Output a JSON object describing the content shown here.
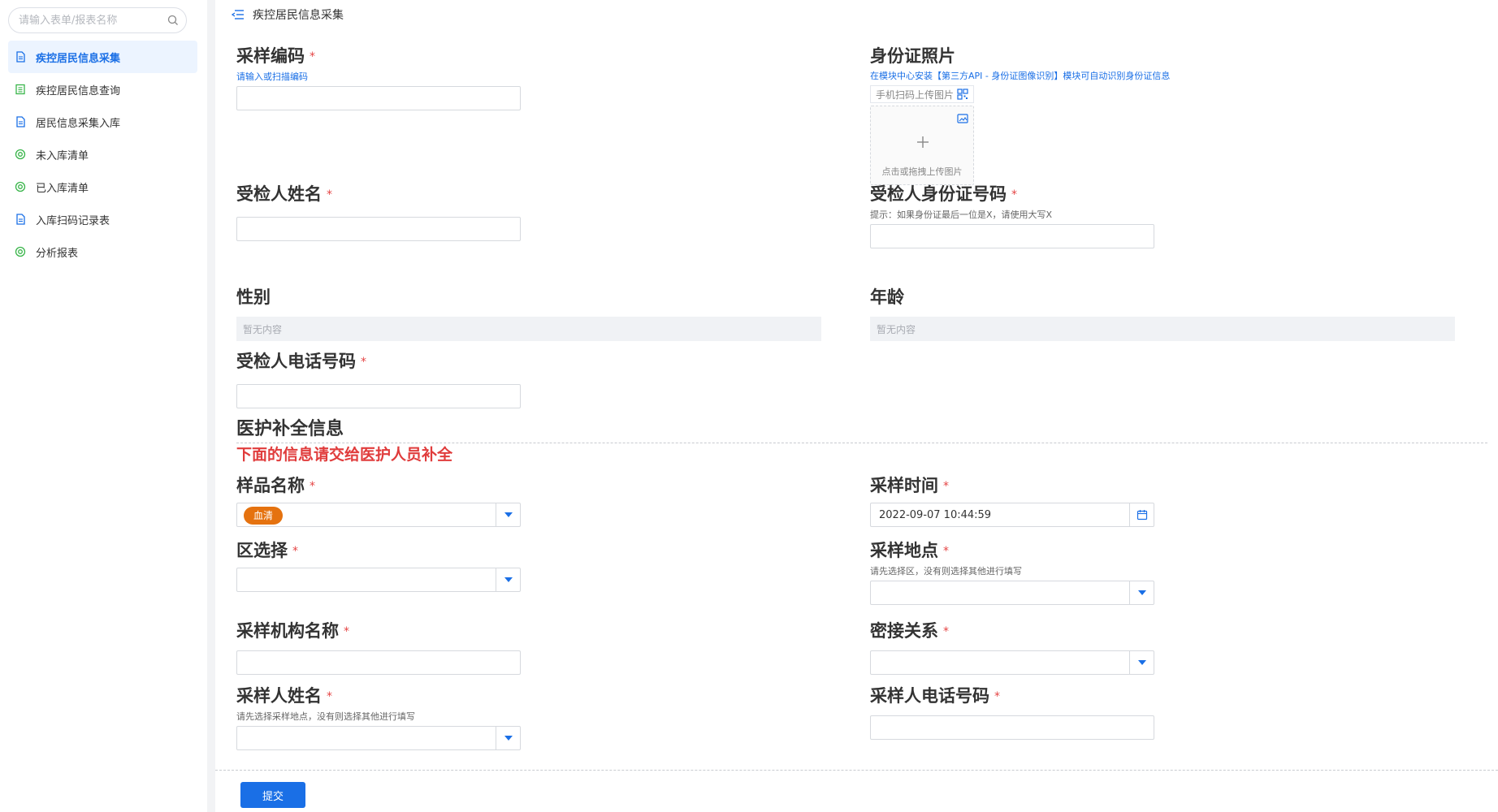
{
  "sidebar": {
    "search_placeholder": "请输入表单/报表名称",
    "items": [
      {
        "label": "疾控居民信息采集",
        "icon": "document-icon"
      },
      {
        "label": "疾控居民信息查询",
        "icon": "list-icon"
      },
      {
        "label": "居民信息采集入库",
        "icon": "document-icon"
      },
      {
        "label": "未入库清单",
        "icon": "circle-target-icon"
      },
      {
        "label": "已入库清单",
        "icon": "circle-target-icon"
      },
      {
        "label": "入库扫码记录表",
        "icon": "document-icon"
      },
      {
        "label": "分析报表",
        "icon": "circle-target-icon"
      }
    ]
  },
  "header": {
    "title": "疾控居民信息采集"
  },
  "form": {
    "sampling_code": {
      "label": "采样编码",
      "hint": "请输入或扫描编码",
      "value": ""
    },
    "id_photo": {
      "label": "身份证照片",
      "hint": "在模块中心安装【第三方API - 身份证图像识别】模块可自动识别身份证信息",
      "mobile_scan": "手机扫码上传图片",
      "upload_text": "点击或拖拽上传图片"
    },
    "name": {
      "label": "受检人姓名",
      "value": ""
    },
    "id_number": {
      "label": "受检人身份证号码",
      "hint": "提示：如果身份证最后一位是X，请使用大写X",
      "value": ""
    },
    "gender": {
      "label": "性别",
      "empty": "暂无内容"
    },
    "age": {
      "label": "年龄",
      "empty": "暂无内容"
    },
    "phone": {
      "label": "受检人电话号码",
      "value": ""
    },
    "section": {
      "title": "医护补全信息",
      "note": "下面的信息请交给医护人员补全"
    },
    "sample_name": {
      "label": "样品名称",
      "tag": "血清"
    },
    "sampling_time": {
      "label": "采样时间",
      "value": "2022-09-07 10:44:59"
    },
    "district": {
      "label": "区选择"
    },
    "sampling_location": {
      "label": "采样地点",
      "hint": "请先选择区，没有则选择其他进行填写"
    },
    "org_name": {
      "label": "采样机构名称",
      "value": ""
    },
    "contact_relation": {
      "label": "密接关系"
    },
    "sampler_name": {
      "label": "采样人姓名",
      "hint": "请先选择采样地点，没有则选择其他进行填写"
    },
    "sampler_phone": {
      "label": "采样人电话号码",
      "value": ""
    },
    "required_mark": "*"
  },
  "submit_label": "提交",
  "colors": {
    "accent": "#1a6fe6",
    "required": "#e54545",
    "tag": "#e5720f",
    "note": "#e03c3c"
  }
}
